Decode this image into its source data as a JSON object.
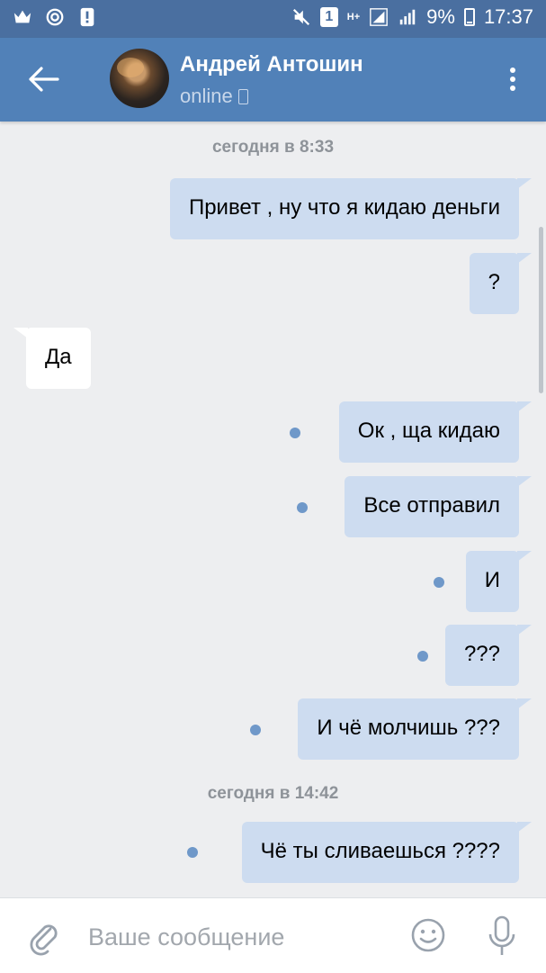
{
  "status_bar": {
    "sim_slot": "1",
    "network": "H+",
    "battery": "9%",
    "time": "17:37"
  },
  "header": {
    "back_icon": "arrow-left-icon",
    "contact_name": "Андрей Антошин",
    "status": "online",
    "status_icon": "mobile-phone-icon",
    "menu_icon": "more-vertical-icon"
  },
  "chat": {
    "date_1": "сегодня в 8:33",
    "date_2": "сегодня в 14:42",
    "messages": [
      {
        "dir": "out",
        "text": "Привет , ну что я кидаю деньги",
        "unread": false
      },
      {
        "dir": "out",
        "text": "?",
        "unread": false
      },
      {
        "dir": "in",
        "text": "Да",
        "unread": false
      },
      {
        "dir": "out",
        "text": "Ок , ща кидаю",
        "unread": true
      },
      {
        "dir": "out",
        "text": "Все отправил",
        "unread": true
      },
      {
        "dir": "out",
        "text": "И",
        "unread": true
      },
      {
        "dir": "out",
        "text": "???",
        "unread": true
      },
      {
        "dir": "out",
        "text": "И чё молчишь ???",
        "unread": true
      },
      {
        "dir": "out",
        "text": "Чё ты сливаешься ????",
        "unread": true
      }
    ]
  },
  "input_bar": {
    "placeholder": "Ваше сообщение",
    "value": "",
    "attach_icon": "paperclip-icon",
    "emoji_icon": "smile-icon",
    "mic_icon": "microphone-icon"
  },
  "colors": {
    "status_bar_bg": "#4a6fa0",
    "header_bg": "#5181b8",
    "chat_bg": "#edeef0",
    "outgoing_bubble": "#cddcf0",
    "incoming_bubble": "#ffffff",
    "unread_dot": "#6f98c9"
  }
}
